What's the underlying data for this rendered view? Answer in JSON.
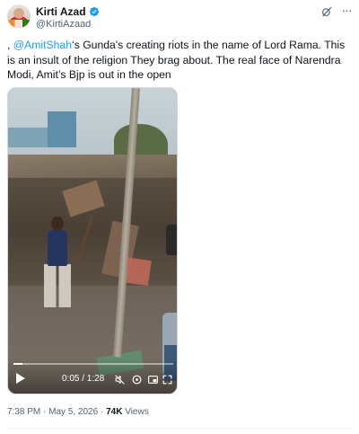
{
  "author": {
    "name": "Kirti Azad",
    "handle": "@KirtiAzaad",
    "verified": true
  },
  "icons": {
    "verified_badge": "verified-badge-icon",
    "grok": "grok-icon",
    "more": "more-icon",
    "play": "play-icon",
    "mute": "mute-icon",
    "settings": "settings-icon",
    "pip": "picture-in-picture-icon",
    "fullscreen": "fullscreen-icon"
  },
  "tweet": {
    "prefix": ", ",
    "mention": "@AmitShah",
    "body": "‘s Gunda's creating riots in the name of Lord Rama. This is an insult of the religion They brag about. The real face of Narendra Modi, Amit’s Bjp is out in the open"
  },
  "video": {
    "current_time": "0:05",
    "duration": "1:28",
    "time_display": "0:05 / 1:28",
    "progress_fraction": 0.057
  },
  "meta": {
    "time": "7:38 PM",
    "separator1": " · ",
    "date": "May 5, 2026",
    "separator2": " · ",
    "views_count": "74K",
    "views_label": " Views"
  },
  "colors": {
    "accent": "#1d9bf0",
    "text": "#0f1419",
    "muted": "#536471"
  }
}
